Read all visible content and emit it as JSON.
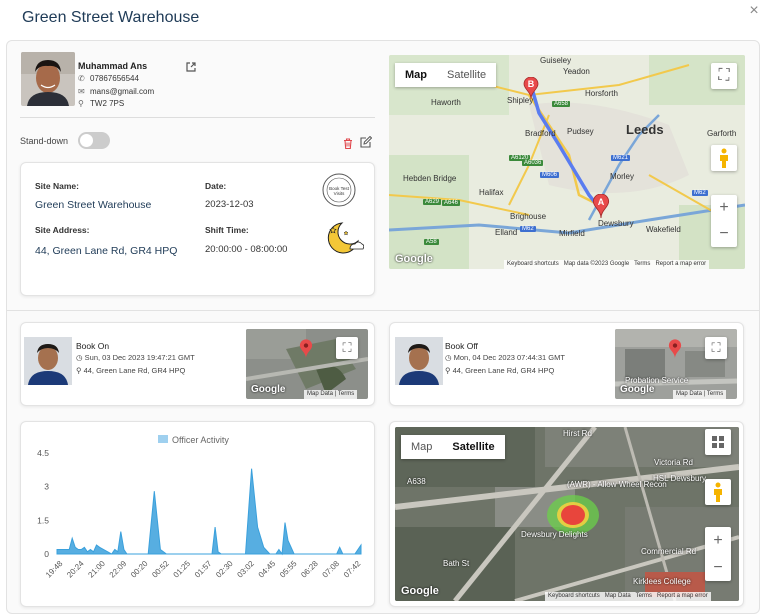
{
  "modal": {
    "title": "Green Street Warehouse",
    "close": "×"
  },
  "officer": {
    "name": "Muhammad Ans",
    "phone": "07867656544",
    "email": "mans@gmail.com",
    "postcode": "TW2 7PS"
  },
  "standdown": {
    "label": "Stand-down"
  },
  "site": {
    "name_label": "Site Name:",
    "name": "Green Street Warehouse",
    "date_label": "Date:",
    "date": "2023-12-03",
    "address_label": "Site Address:",
    "address": "44, Green Lane Rd, GR4 HPQ",
    "shift_label": "Shift Time:",
    "shift": "20:00:00 - 08:00:00",
    "stamp_text": "Book Test Visits"
  },
  "route_map": {
    "tabs": [
      "Map",
      "Satellite"
    ],
    "active_tab": "Map",
    "places": [
      "Guiseley",
      "Yeadon",
      "Shipley",
      "Horsforth",
      "Haworth",
      "Leeds",
      "Bradford",
      "Pudsey",
      "Garforth",
      "Hebden Bridge",
      "Halifax",
      "Morley",
      "Brighouse",
      "Elland",
      "Mirfield",
      "Dewsbury",
      "Wakefield"
    ],
    "roads": [
      "A658",
      "A6120",
      "M621",
      "M606",
      "A6036",
      "A629",
      "A646",
      "M62",
      "A58",
      "M62"
    ],
    "marker_a": "A",
    "marker_b": "B",
    "google": "Google",
    "attribution": [
      "Keyboard shortcuts",
      "Map data ©2023 Google",
      "Terms",
      "Report a map error"
    ]
  },
  "book_on": {
    "title": "Book On",
    "time": "Sun, 03 Dec 2023 19:47:21 GMT",
    "address": "44, Green Lane Rd, GR4 HPQ",
    "google": "Google",
    "attribution": [
      "Map Data",
      "Terms"
    ]
  },
  "book_off": {
    "title": "Book Off",
    "time": "Mon, 04 Dec 2023 07:44:31 GMT",
    "address": "44, Green Lane Rd, GR4 HPQ",
    "map_label": "Probation Service",
    "google": "Google",
    "attribution": [
      "Map Data",
      "Terms"
    ]
  },
  "heat_map": {
    "tabs": [
      "Map",
      "Satellite"
    ],
    "active_tab": "Satellite",
    "labels": [
      "Hirst Rd",
      "Victoria Rd",
      "(AWR) - Allow Wheel Recon",
      "HSL Dewsbury",
      "Dewsbury Delights",
      "Commercial Rd",
      "Kirklees College",
      "A638",
      "Bath St"
    ],
    "google": "Google",
    "attribution": [
      "Keyboard shortcuts",
      "Map Data",
      "Terms",
      "Report a map error"
    ]
  },
  "icons": {
    "phone": "phone-icon",
    "email": "email-icon",
    "location": "location-pin-icon",
    "clock": "clock-icon",
    "trash": "trash-icon",
    "edit": "edit-icon",
    "external": "external-link-icon",
    "fullscreen": "fullscreen-icon",
    "pegman": "street-view-pegman-icon",
    "moon": "moon-night-icon"
  },
  "chart_data": {
    "type": "line",
    "legend": "Officer Activity",
    "legend_position": "top",
    "color": "#3aa0dc",
    "y_ticks": [
      0,
      1.5,
      3,
      4.5
    ],
    "ylim": [
      0,
      4.5
    ],
    "x_ticks": [
      "19:48",
      "20:24",
      "21:00",
      "22:09",
      "00:20",
      "00:52",
      "01:25",
      "01:57",
      "02:30",
      "03:02",
      "04:45",
      "05:55",
      "06:28",
      "07:08",
      "07:42"
    ],
    "x": [
      0,
      0.02,
      0.04,
      0.05,
      0.06,
      0.07,
      0.08,
      0.09,
      0.1,
      0.11,
      0.12,
      0.13,
      0.14,
      0.18,
      0.185,
      0.19,
      0.2,
      0.21,
      0.22,
      0.23,
      0.24,
      0.26,
      0.28,
      0.3,
      0.32,
      0.34,
      0.36,
      0.38,
      0.4,
      0.42,
      0.44,
      0.46,
      0.48,
      0.5,
      0.51,
      0.52,
      0.53,
      0.54,
      0.56,
      0.58,
      0.6,
      0.62,
      0.64,
      0.66,
      0.68,
      0.7,
      0.71,
      0.72,
      0.73,
      0.74,
      0.75,
      0.76,
      0.78,
      0.8,
      0.82,
      0.84,
      0.86,
      0.88,
      0.9,
      0.92,
      0.93,
      0.94,
      0.95,
      0.96,
      0.98,
      1.0
    ],
    "values": [
      0.2,
      0.2,
      0.2,
      0.7,
      0.3,
      0.2,
      0.2,
      0.3,
      0.1,
      0.2,
      0.1,
      0.4,
      0.3,
      0.0,
      0.1,
      0.2,
      0.1,
      1.0,
      0.2,
      0.0,
      0.0,
      0.0,
      0.0,
      0.0,
      2.8,
      0.2,
      0.0,
      0.0,
      0.0,
      0.0,
      0.0,
      0.0,
      0.0,
      0.0,
      0.0,
      1.2,
      0.1,
      0.0,
      0.0,
      0.0,
      0.0,
      0.0,
      3.8,
      1.2,
      0.3,
      0.0,
      0.0,
      0.0,
      0.2,
      0.0,
      1.4,
      0.6,
      0.0,
      0.0,
      0.0,
      0.0,
      0.0,
      0.0,
      0.0,
      0.0,
      0.3,
      0.0,
      0.0,
      0.0,
      0.0,
      0.4
    ]
  }
}
